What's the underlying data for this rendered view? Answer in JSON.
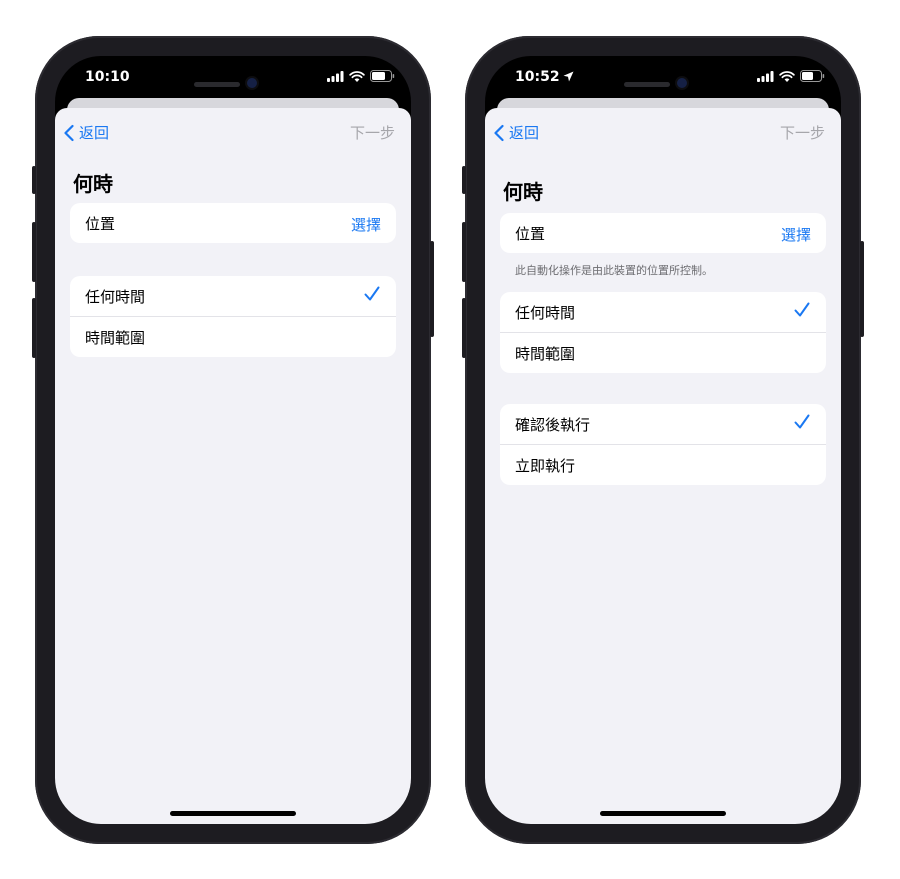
{
  "colors": {
    "accent": "#1a78f2",
    "disabled": "#a6a6ab",
    "background": "#f2f2f7"
  },
  "left": {
    "status": {
      "time": "10:10",
      "icons": [
        "signal-icon",
        "wifi-icon",
        "battery-icon"
      ]
    },
    "nav": {
      "back_label": "返回",
      "next_label": "下一步"
    },
    "title": "何時",
    "location": {
      "label": "位置",
      "action": "選擇"
    },
    "time_options": [
      {
        "label": "任何時間",
        "selected": true
      },
      {
        "label": "時間範圍",
        "selected": false
      }
    ]
  },
  "right": {
    "status": {
      "time": "10:52",
      "icons": [
        "location-arrow-icon",
        "signal-icon",
        "wifi-icon",
        "battery-icon"
      ]
    },
    "nav": {
      "back_label": "返回",
      "next_label": "下一步"
    },
    "title": "何時",
    "location": {
      "label": "位置",
      "action": "選擇",
      "footnote": "此自動化操作是由此裝置的位置所控制。"
    },
    "time_options": [
      {
        "label": "任何時間",
        "selected": true
      },
      {
        "label": "時間範圍",
        "selected": false
      }
    ],
    "run_options": [
      {
        "label": "確認後執行",
        "selected": true
      },
      {
        "label": "立即執行",
        "selected": false
      }
    ]
  }
}
